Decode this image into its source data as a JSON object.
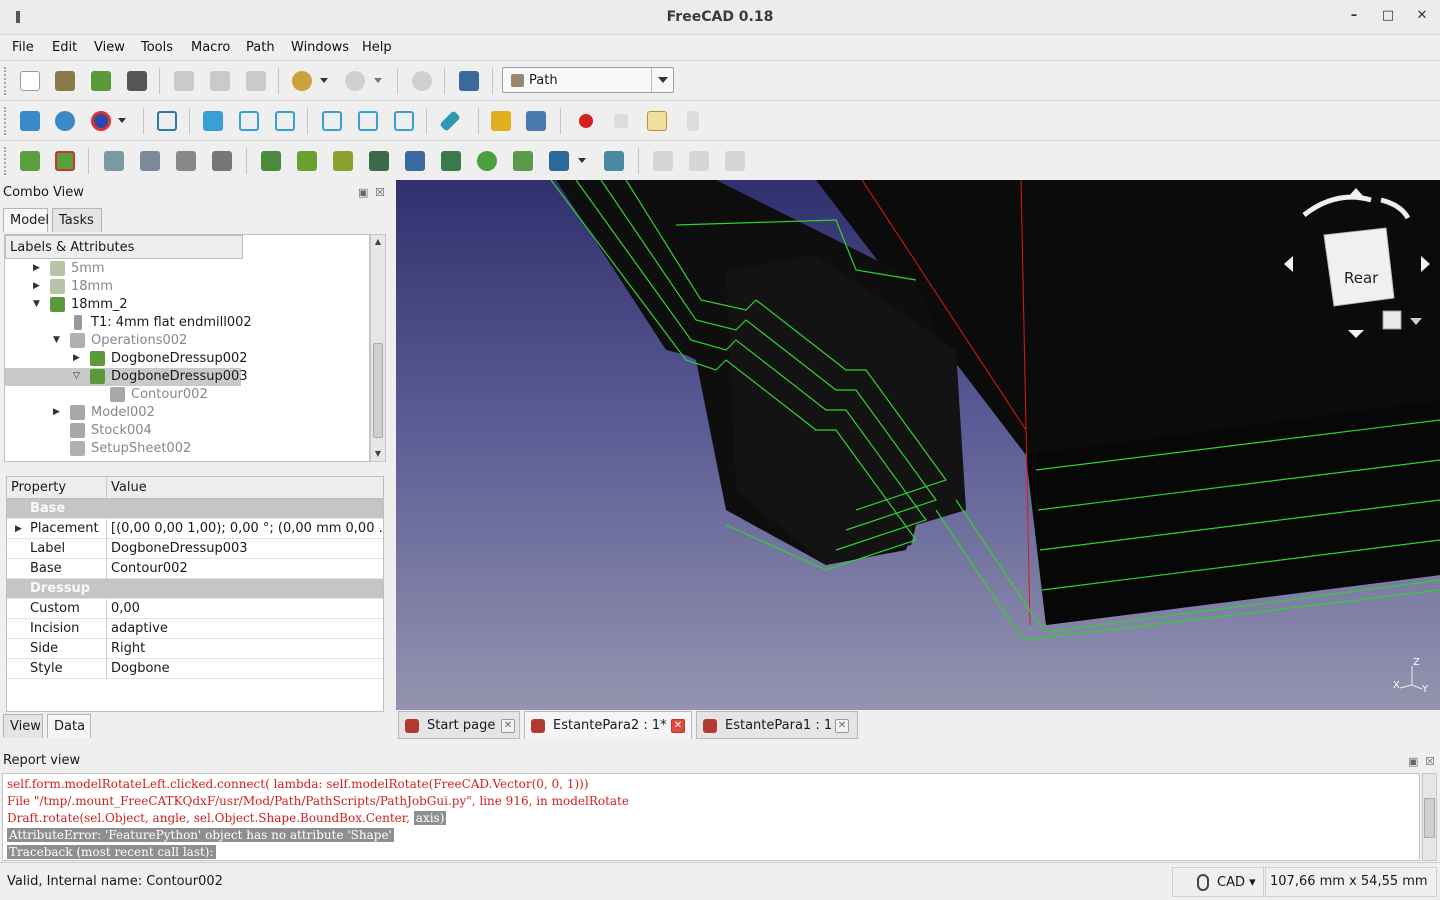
{
  "window": {
    "title": "FreeCAD 0.18",
    "minimize_label": "–",
    "maximize_label": "□",
    "close_label": "✕"
  },
  "menubar": {
    "items": [
      "File",
      "Edit",
      "View",
      "Tools",
      "Macro",
      "Path",
      "Windows",
      "Help"
    ]
  },
  "toolbar": {
    "workbench": "Path",
    "workbench_icon": "path-workbench-icon"
  },
  "combo_view": {
    "title": "Combo View",
    "tabs": [
      "Model",
      "Tasks"
    ],
    "tree_header": "Labels & Attributes",
    "tree": [
      {
        "label": "5mm",
        "icon": "job-icon",
        "expander": "▶",
        "muted": true
      },
      {
        "label": "18mm",
        "icon": "job-icon",
        "expander": "▶",
        "muted": true
      },
      {
        "label": "18mm_2",
        "icon": "job-icon",
        "expander": "▼",
        "muted": false
      },
      {
        "label": "T1: 4mm flat endmill002",
        "icon": "tool-icon",
        "expander": "",
        "muted": false
      },
      {
        "label": "Operations002",
        "icon": "operations-icon",
        "expander": "▼",
        "muted": true
      },
      {
        "label": "DogboneDressup002",
        "icon": "dressup-icon",
        "expander": "▶",
        "muted": false
      },
      {
        "label": "DogboneDressup003",
        "icon": "dressup-icon",
        "expander": "▽",
        "muted": false,
        "selected": true
      },
      {
        "label": "Contour002",
        "icon": "contour-icon",
        "expander": "",
        "muted": true
      },
      {
        "label": "Model002",
        "icon": "folder-icon",
        "expander": "▶",
        "muted": true
      },
      {
        "label": "Stock004",
        "icon": "stock-icon",
        "expander": "",
        "muted": true
      },
      {
        "label": "SetupSheet002",
        "icon": "setupsheet-icon",
        "expander": "",
        "muted": true
      }
    ],
    "property_header": "Property",
    "value_header": "Value",
    "properties": [
      {
        "group": "Base"
      },
      {
        "name": "Placement",
        "value": "[(0,00 0,00 1,00); 0,00 °; (0,00 mm  0,00 ...",
        "expandable": true
      },
      {
        "name": "Label",
        "value": "DogboneDressup003"
      },
      {
        "name": "Base",
        "value": "Contour002"
      },
      {
        "group": "Dressup"
      },
      {
        "name": "Custom",
        "value": "0,00"
      },
      {
        "name": "Incision",
        "value": "adaptive"
      },
      {
        "name": "Side",
        "value": "Right"
      },
      {
        "name": "Style",
        "value": "Dogbone"
      }
    ],
    "bottom_tabs": [
      "View",
      "Data"
    ]
  },
  "view3d": {
    "navcube_face": "Rear",
    "axis_labels": {
      "x": "X",
      "y": "Y",
      "z": "Z"
    }
  },
  "doc_tabs": [
    {
      "label": "Start page",
      "active": false
    },
    {
      "label": "EstantePara2 : 1*",
      "active": true
    },
    {
      "label": "EstantePara1 : 1",
      "active": false
    }
  ],
  "report_view": {
    "title": "Report view",
    "lines": [
      "    self.form.modelRotateLeft.clicked.connect(       lambda: self.modelRotate(FreeCAD.Vector(0, 0,  1)))",
      "  File \"/tmp/.mount_FreeCATKQdxF/usr/Mod/Path/PathScripts/PathJobGui.py\", line 916, in modelRotate",
      "    Draft.rotate(sel.Object, angle, sel.Object.Shape.BoundBox.Center, ",
      "AttributeError: 'FeaturePython' object has no attribute 'Shape'",
      "Traceback (most recent call last):"
    ],
    "highlight_axis": "axis)"
  },
  "statusbar": {
    "message": "Valid, Internal name: Contour002",
    "nav_style": "CAD",
    "dimensions": "107,66 mm x 54,55 mm"
  },
  "colors": {
    "path_green": "#2fd32f",
    "model_black": "#0a0a0a",
    "error_red": "#d11f1f",
    "bg_top": "#30306e",
    "bg_bottom": "#9494b0"
  }
}
